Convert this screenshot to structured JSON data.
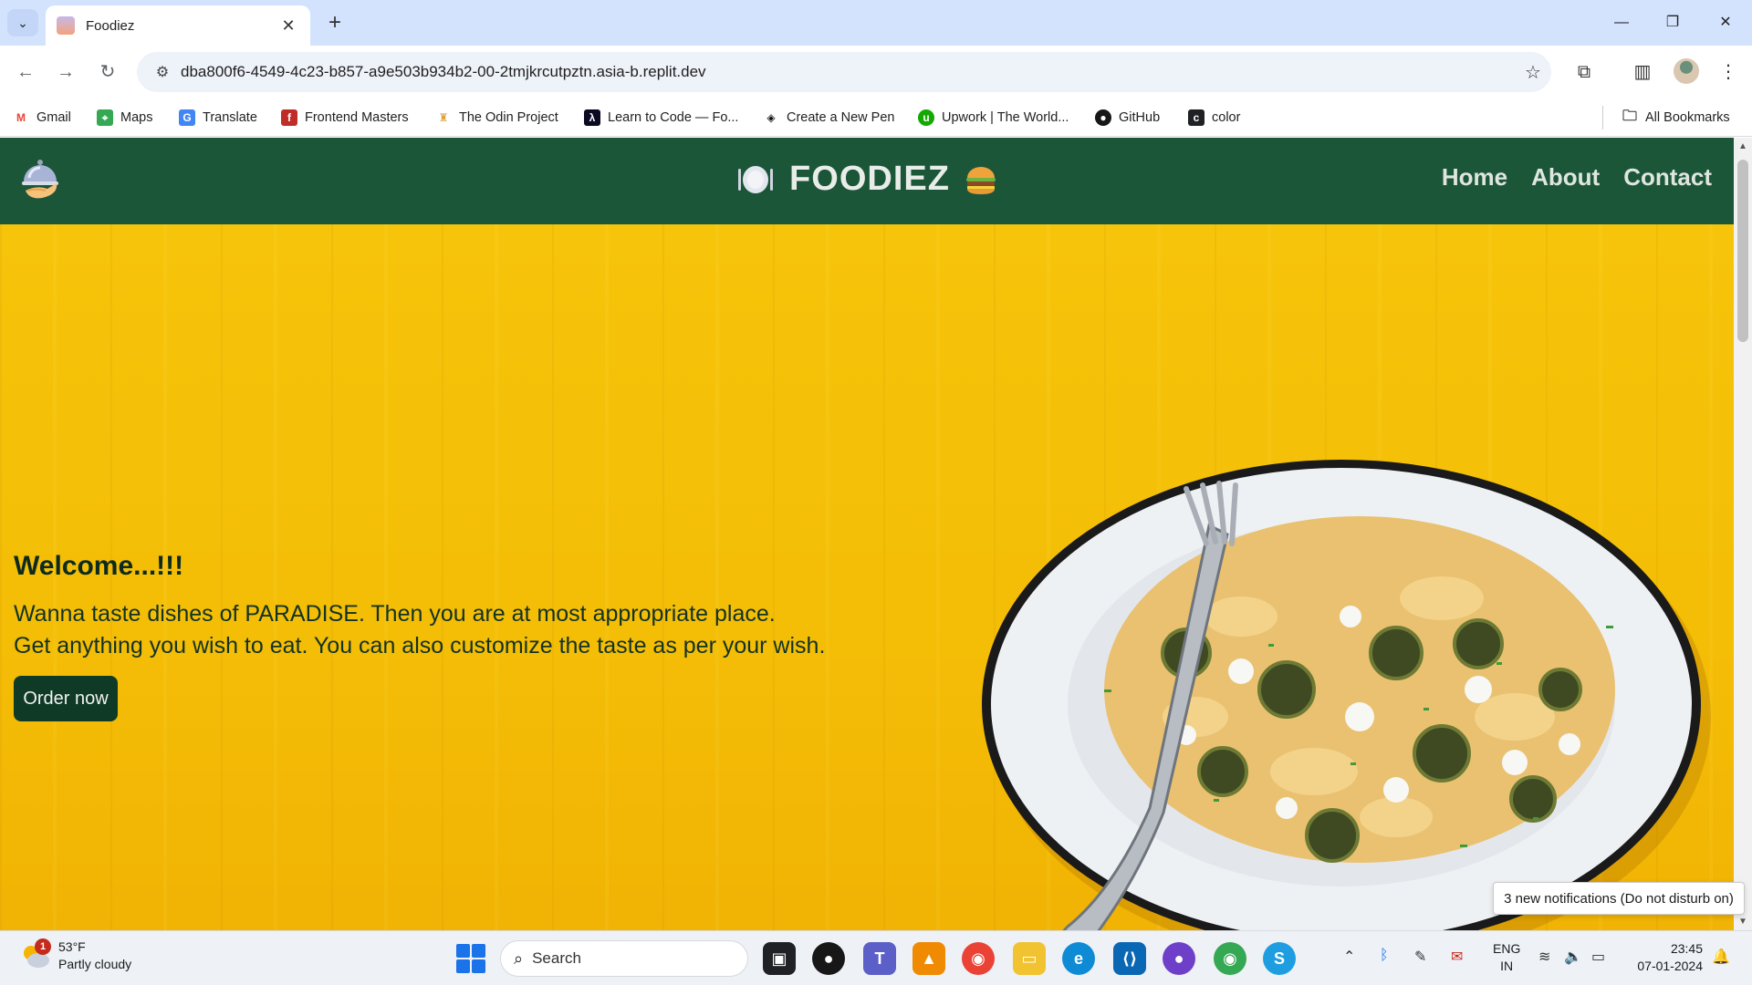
{
  "browser": {
    "tab_title": "Foodiez",
    "url": "dba800f6-4549-4c23-b857-a9e503b934b2-00-2tmjkrcutpztn.asia-b.replit.dev",
    "bookmarks": [
      {
        "label": "Gmail",
        "icon": "gmail-icon",
        "color": "#ea4335"
      },
      {
        "label": "Maps",
        "icon": "maps-icon",
        "color": "#34a853"
      },
      {
        "label": "Translate",
        "icon": "translate-icon",
        "color": "#4285f4"
      },
      {
        "label": "Frontend Masters",
        "icon": "frontend-masters-icon",
        "color": "#c02d28"
      },
      {
        "label": "The Odin Project",
        "icon": "odin-project-icon",
        "color": "#d9a441"
      },
      {
        "label": "Learn to Code — Fo...",
        "icon": "freecodecamp-icon",
        "color": "#0a0a23"
      },
      {
        "label": "Create a New Pen",
        "icon": "codepen-icon",
        "color": "#111111"
      },
      {
        "label": "Upwork | The World...",
        "icon": "upwork-icon",
        "color": "#14a800"
      },
      {
        "label": "GitHub",
        "icon": "github-icon",
        "color": "#181717"
      },
      {
        "label": "color",
        "icon": "color-icon",
        "color": "#202124"
      }
    ],
    "all_bookmarks": "All Bookmarks"
  },
  "site": {
    "brand": "FOODIEZ",
    "nav": [
      "Home",
      "About",
      "Contact"
    ],
    "welcome": "Welcome...!!!",
    "intro_line1": "Wanna taste dishes of PARADISE. Then you are at most appropriate place.",
    "intro_line2": "Get anything you wish to eat. You can also customize the taste as per your wish.",
    "order_button": "Order now",
    "colors": {
      "header": "#1c5638",
      "hero": "#f5c10a",
      "button": "#0f3a26"
    }
  },
  "notification": "3 new notifications (Do not disturb on)",
  "taskbar": {
    "weather_badge": "1",
    "temperature": "53°F",
    "condition": "Partly cloudy",
    "search_label": "Search",
    "lang_line1": "ENG",
    "lang_line2": "IN",
    "time": "23:45",
    "date": "07-01-2024"
  }
}
